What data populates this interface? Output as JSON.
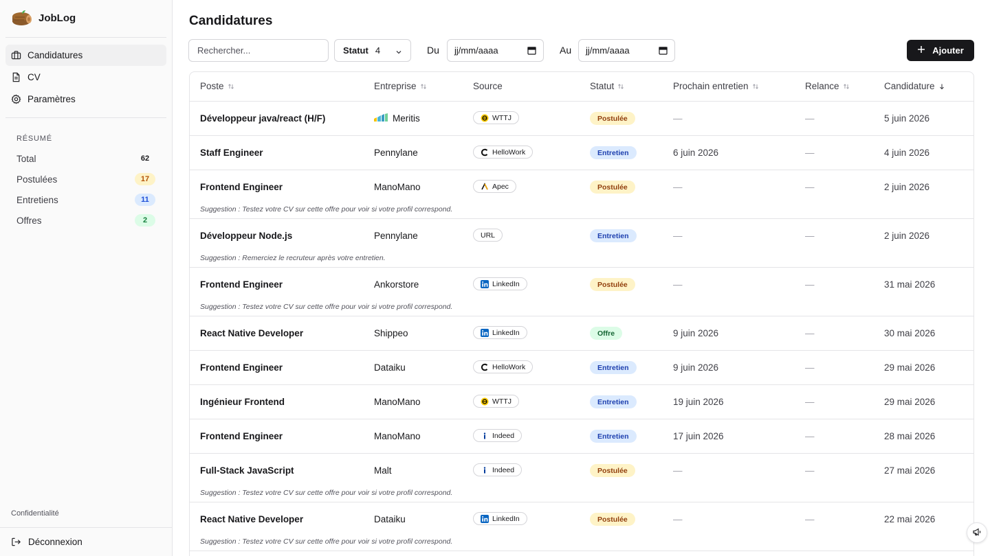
{
  "app": {
    "name": "JobLog"
  },
  "nav": [
    {
      "label": "Candidatures",
      "icon": "briefcase-icon",
      "active": true
    },
    {
      "label": "CV",
      "icon": "file-icon",
      "active": false
    },
    {
      "label": "Paramètres",
      "icon": "gear-icon",
      "active": false
    }
  ],
  "summary": {
    "title": "RÉSUMÉ",
    "items": [
      {
        "label": "Total",
        "count": "62"
      },
      {
        "label": "Postulées",
        "count": "17"
      },
      {
        "label": "Entretiens",
        "count": "11"
      },
      {
        "label": "Offres",
        "count": "2"
      }
    ]
  },
  "footer": {
    "privacy": "Confidentialité",
    "logout": "Déconnexion"
  },
  "page": {
    "title": "Candidatures"
  },
  "toolbar": {
    "search_placeholder": "Rechercher...",
    "status_label": "Statut",
    "status_count": "4",
    "from_label": "Du",
    "from_value": "jj/mm/aaaa",
    "to_label": "Au",
    "to_value": "jj/mm/aaaa",
    "add_label": "Ajouter"
  },
  "table": {
    "headers": {
      "poste": "Poste",
      "entreprise": "Entreprise",
      "source": "Source",
      "statut": "Statut",
      "prochain": "Prochain entretien",
      "relance": "Relance",
      "candidature": "Candidature"
    },
    "rows": [
      {
        "poste": "Développeur java/react (H/F)",
        "entreprise": "Meritis",
        "source": "WTTJ",
        "statut": "Postulée",
        "statut_type": "postulee",
        "prochain": "—",
        "relance": "—",
        "candidature": "5 juin 2026",
        "suggestion": ""
      },
      {
        "poste": "Staff Engineer",
        "entreprise": "Pennylane",
        "source": "HelloWork",
        "statut": "Entretien",
        "statut_type": "entretien",
        "prochain": "6 juin 2026",
        "relance": "—",
        "candidature": "4 juin 2026",
        "suggestion": ""
      },
      {
        "poste": "Frontend Engineer",
        "entreprise": "ManoMano",
        "source": "Apec",
        "statut": "Postulée",
        "statut_type": "postulee",
        "prochain": "—",
        "relance": "—",
        "candidature": "2 juin 2026",
        "suggestion": "Suggestion : Testez votre CV sur cette offre pour voir si votre profil correspond."
      },
      {
        "poste": "Développeur Node.js",
        "entreprise": "Pennylane",
        "source": "URL",
        "statut": "Entretien",
        "statut_type": "entretien",
        "prochain": "—",
        "relance": "—",
        "candidature": "2 juin 2026",
        "suggestion": "Suggestion : Remerciez le recruteur après votre entretien."
      },
      {
        "poste": "Frontend Engineer",
        "entreprise": "Ankorstore",
        "source": "LinkedIn",
        "statut": "Postulée",
        "statut_type": "postulee",
        "prochain": "—",
        "relance": "—",
        "candidature": "31 mai 2026",
        "suggestion": "Suggestion : Testez votre CV sur cette offre pour voir si votre profil correspond."
      },
      {
        "poste": "React Native Developer",
        "entreprise": "Shippeo",
        "source": "LinkedIn",
        "statut": "Offre",
        "statut_type": "offre",
        "prochain": "9 juin 2026",
        "relance": "—",
        "candidature": "30 mai 2026",
        "suggestion": ""
      },
      {
        "poste": "Frontend Engineer",
        "entreprise": "Dataiku",
        "source": "HelloWork",
        "statut": "Entretien",
        "statut_type": "entretien",
        "prochain": "9 juin 2026",
        "relance": "—",
        "candidature": "29 mai 2026",
        "suggestion": ""
      },
      {
        "poste": "Ingénieur Frontend",
        "entreprise": "ManoMano",
        "source": "WTTJ",
        "statut": "Entretien",
        "statut_type": "entretien",
        "prochain": "19 juin 2026",
        "relance": "—",
        "candidature": "29 mai 2026",
        "suggestion": ""
      },
      {
        "poste": "Frontend Engineer",
        "entreprise": "ManoMano",
        "source": "Indeed",
        "statut": "Entretien",
        "statut_type": "entretien",
        "prochain": "17 juin 2026",
        "relance": "—",
        "candidature": "28 mai 2026",
        "suggestion": ""
      },
      {
        "poste": "Full-Stack JavaScript",
        "entreprise": "Malt",
        "source": "Indeed",
        "statut": "Postulée",
        "statut_type": "postulee",
        "prochain": "—",
        "relance": "—",
        "candidature": "27 mai 2026",
        "suggestion": "Suggestion : Testez votre CV sur cette offre pour voir si votre profil correspond."
      },
      {
        "poste": "React Native Developer",
        "entreprise": "Dataiku",
        "source": "LinkedIn",
        "statut": "Postulée",
        "statut_type": "postulee",
        "prochain": "—",
        "relance": "—",
        "candidature": "22 mai 2026",
        "suggestion": "Suggestion : Testez votre CV sur cette offre pour voir si votre profil correspond."
      }
    ]
  },
  "colors": {
    "accent": "#18181b",
    "postulee_bg": "#fef3c7",
    "entretien_bg": "#dbeafe",
    "offre_bg": "#dcfce7",
    "linkedin": "#0a66c2",
    "wttj": "#ffcd00"
  }
}
